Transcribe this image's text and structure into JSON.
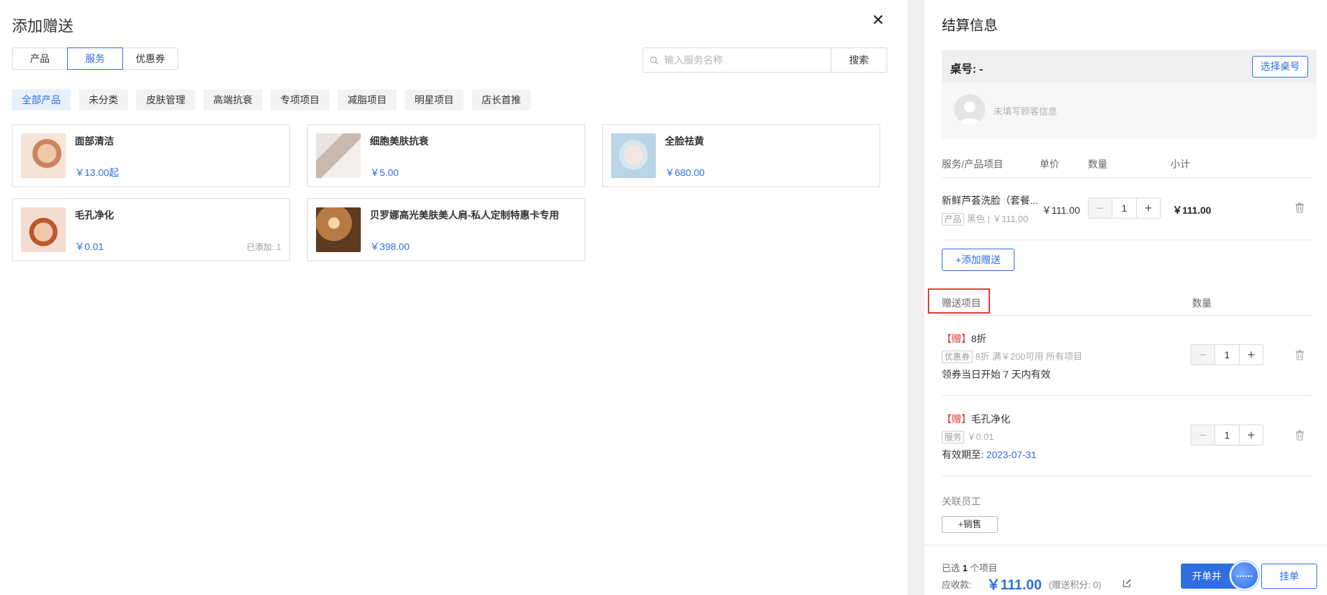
{
  "modal": {
    "title": "添加赠送",
    "tabs": [
      "产品",
      "服务",
      "优惠券"
    ],
    "active_tab": 1,
    "search": {
      "placeholder": "输入服务名称",
      "button": "搜索"
    },
    "categories": [
      "全部产品",
      "未分类",
      "皮肤管理",
      "高端抗衰",
      "专项项目",
      "减脂项目",
      "明星项目",
      "店长首推"
    ],
    "active_category": 0,
    "cards": [
      {
        "name": "面部清洁",
        "price": "￥13.00起",
        "added": ""
      },
      {
        "name": "细胞美肤抗衰",
        "price": "￥5.00",
        "added": ""
      },
      {
        "name": "全脸祛黄",
        "price": "￥680.00",
        "added": ""
      },
      {
        "name": "毛孔净化",
        "price": "￥0.01",
        "added": "已添加: 1"
      },
      {
        "name": "贝罗娜高光美肤美人肩-私人定制特惠卡专用",
        "price": "￥398.00",
        "added": ""
      }
    ]
  },
  "settle": {
    "title": "结算信息",
    "table_label": "桌号: -",
    "table_button": "选择桌号",
    "customer_empty": "未填写顾客信息",
    "columns": {
      "item": "服务/产品项目",
      "price": "单价",
      "qty": "数量",
      "subtotal": "小计"
    },
    "item": {
      "name": "新鲜芦荟洗脸（套餐...",
      "tag": "产品",
      "sub": "黑色 | ￥111.00",
      "price": "￥111.00",
      "qty": "1",
      "subtotal": "￥111.00"
    },
    "add_gift_button": "+添加赠送",
    "gift_header": "赠送项目",
    "gift_qty_header": "数量",
    "gifts": [
      {
        "prefix": "【赠】",
        "name": "8折",
        "tag": "优惠券",
        "sub": "8折 满￥200可用 所有项目",
        "note": "领券当日开始 7 天内有效",
        "note_date": "",
        "qty": "1"
      },
      {
        "prefix": "【赠】",
        "name": "毛孔净化",
        "tag": "服务",
        "sub": "￥0.01",
        "note": "有效期至: ",
        "note_date": "2023-07-31",
        "qty": "1"
      }
    ],
    "staff_label": "关联员工",
    "sales_button": "+销售",
    "footer": {
      "selected_prefix": "已选 ",
      "selected_count": "1",
      "selected_suffix": " 个项目",
      "due_label": "应收款:",
      "due_amount": "￥111.00",
      "gift_points": "(赠送积分: 0)",
      "open_button": "开单并",
      "hold_button": "挂单"
    }
  },
  "colors": {
    "accent": "#2f6de1",
    "danger": "#e53935"
  }
}
